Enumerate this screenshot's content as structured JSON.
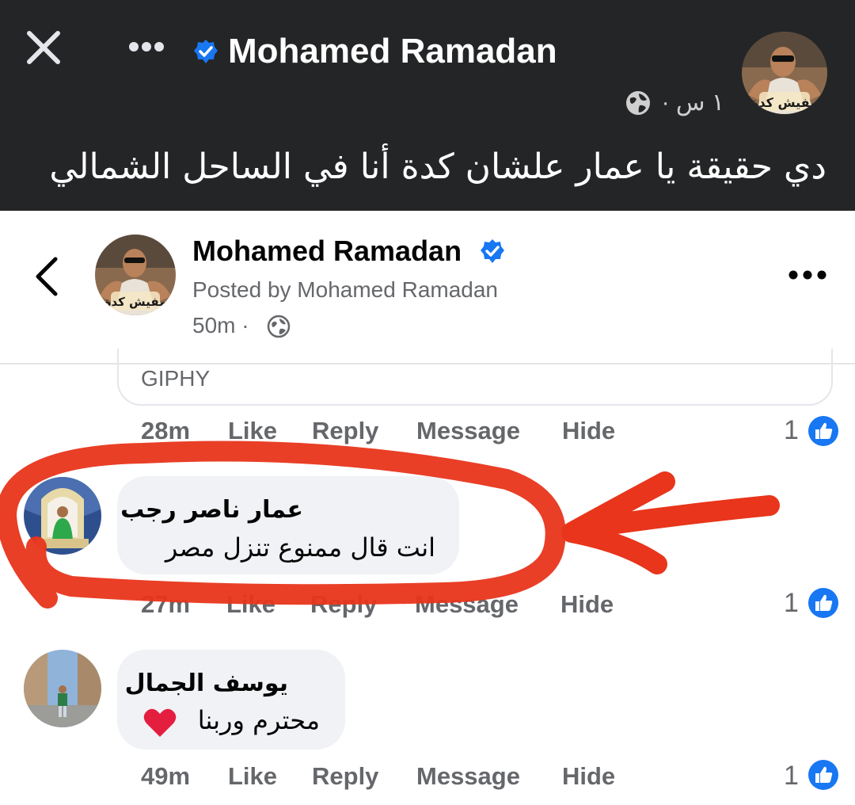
{
  "overlay": {
    "page_name": "Mohamed Ramadan",
    "time_ago": "١ س ·",
    "caption": "دي حقيقة يا عمار علشان كدة أنا في الساحل الشمالي",
    "avatar_text": "مفيش كدة"
  },
  "header": {
    "name": "Mohamed Ramadan",
    "posted_by": "Posted by Mohamed Ramadan",
    "time": "50m ·",
    "avatar_text": "مفيش كدة"
  },
  "giphy": {
    "label": "GIPHY"
  },
  "actions": {
    "like": "Like",
    "reply": "Reply",
    "message": "Message",
    "hide": "Hide"
  },
  "comments": [
    {
      "time": "28m",
      "likes": "1"
    },
    {
      "author": "عمار ناصر رجب",
      "text": "انت قال ممنوع تنزل مصر",
      "time": "27m",
      "likes": "1"
    },
    {
      "author": "يوسف الجمال",
      "text": "محترم وربنا",
      "time": "49m",
      "likes": "1"
    }
  ],
  "colors": {
    "topbar": "#242526",
    "verified": "#1877f2",
    "annotation": "#e8351b",
    "bubble": "#f0f2f5",
    "meta": "#65676b"
  }
}
